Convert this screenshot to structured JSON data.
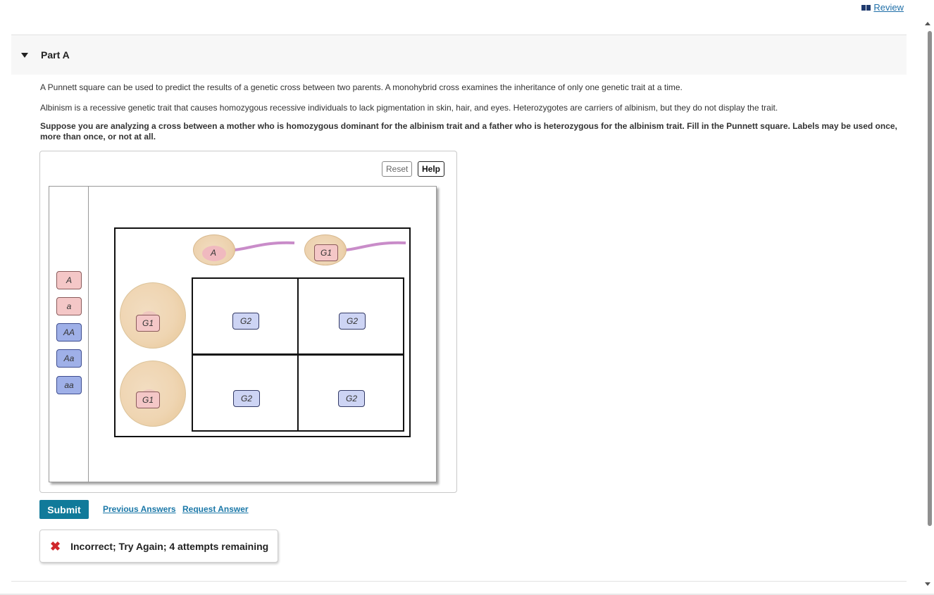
{
  "header": {
    "review_label": " Review"
  },
  "part": {
    "title": "Part A"
  },
  "question": {
    "p1": "A Punnett square can be used to predict the results of a genetic cross between two parents. A monohybrid cross examines the inheritance of only one genetic trait at a time.",
    "p2": "Albinism is a recessive genetic trait that causes homozygous recessive individuals to lack pigmentation in skin, hair, and eyes. Heterozygotes are carriers of albinism, but they do not display the trait.",
    "p3": "Suppose you are analyzing a cross between a mother who is homozygous dominant for the albinism trait and a father who is heterozygous for the albinism trait. Fill in the Punnett square. Labels may be used once, more than once, or not at all."
  },
  "toolbar": {
    "reset_label": "Reset",
    "help_label": "Help"
  },
  "palette": {
    "labels": [
      {
        "text": "A",
        "color": "#f4c7c7"
      },
      {
        "text": "a",
        "color": "#f4c7c7"
      },
      {
        "text": "AA",
        "color": "#9fb0e8"
      },
      {
        "text": "Aa",
        "color": "#9fb0e8"
      },
      {
        "text": "aa",
        "color": "#9fb0e8"
      }
    ]
  },
  "punnett": {
    "sperm_labels": [
      "A",
      "G1"
    ],
    "egg_labels": [
      "G1",
      "G1"
    ],
    "cell_labels": [
      "G2",
      "G2",
      "G2",
      "G2"
    ]
  },
  "actions": {
    "submit_label": "Submit",
    "previous_answers": "Previous Answers",
    "request_answer": "Request Answer"
  },
  "feedback": {
    "icon": "close-icon",
    "text": "Incorrect; Try Again; 4 attempts remaining",
    "color": "#d0272b"
  }
}
